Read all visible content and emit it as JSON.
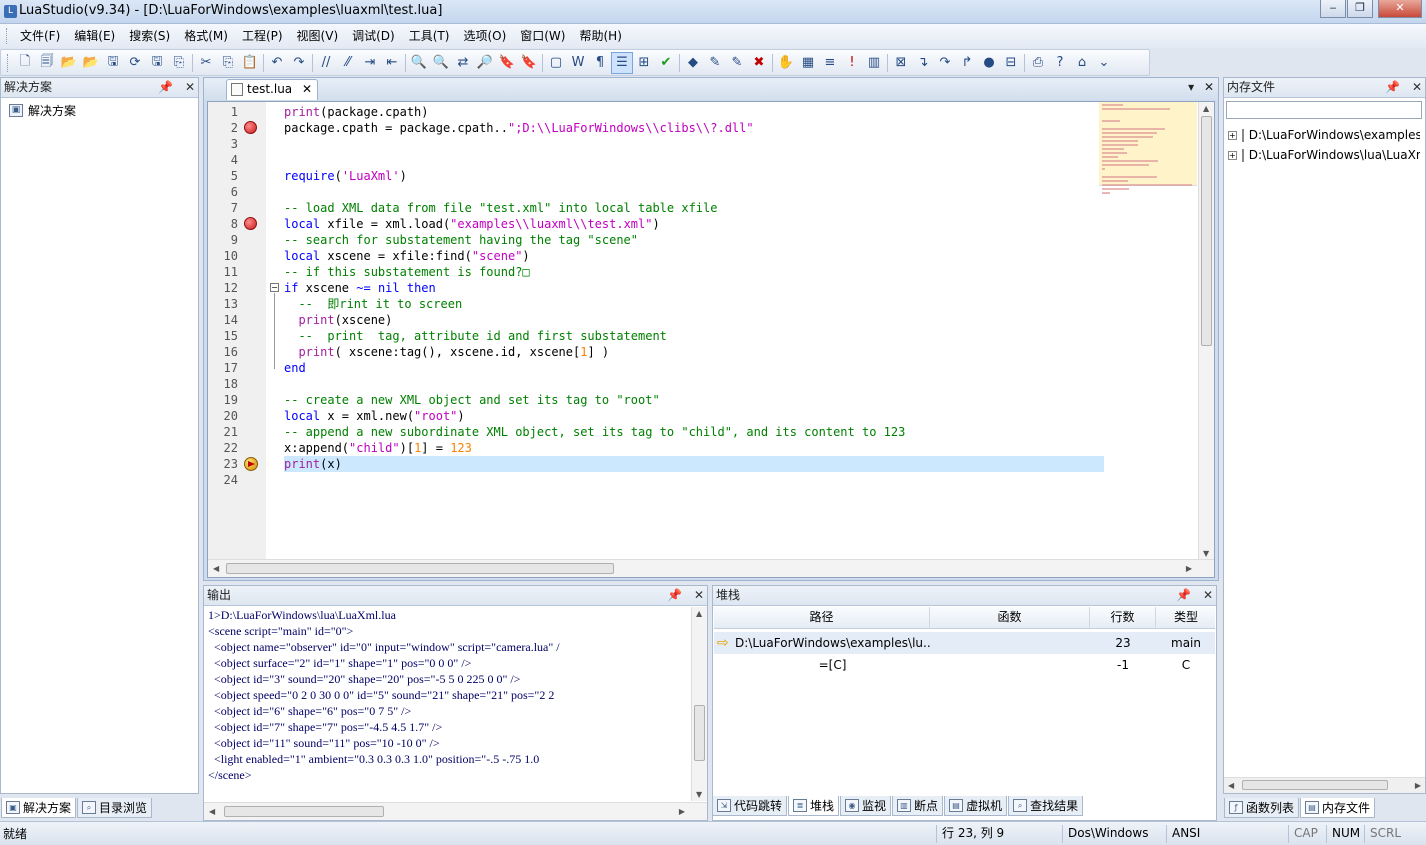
{
  "window": {
    "title": "LuaStudio(v9.34) - [D:\\LuaForWindows\\examples\\luaxml\\test.lua]",
    "buttons": {
      "minimize": "‒",
      "maximize": "❐",
      "close": "✕"
    }
  },
  "menu": [
    "文件(F)",
    "编辑(E)",
    "搜索(S)",
    "格式(M)",
    "工程(P)",
    "视图(V)",
    "调试(D)",
    "工具(T)",
    "选项(O)",
    "窗口(W)",
    "帮助(H)"
  ],
  "toolbar": {
    "icons": [
      "new-file-icon",
      "new-project-icon",
      "open-icon",
      "open-project-icon",
      "save-all-icon",
      "reload-icon",
      "save-icon",
      "save-copy-icon",
      "cut-icon",
      "copy-icon",
      "paste-icon",
      "undo-icon",
      "redo-icon",
      "comment-icon",
      "uncomment-icon",
      "indent-icon",
      "outdent-icon",
      "find-icon",
      "find-next-icon",
      "replace-icon",
      "find-in-files-icon",
      "bookmark-icon",
      "bookmark-next-icon",
      "frame-icon",
      "word-wrap-icon",
      "pilcrow-icon",
      "line-numbers-icon",
      "tree-icon",
      "check-icon",
      "compile-icon",
      "build-icon",
      "run-icon",
      "stop-icon",
      "hand-icon",
      "ruler-icon",
      "list-icon",
      "exclamation-icon",
      "columns-icon",
      "debug-icon",
      "step-into-icon",
      "step-over-icon",
      "step-out-icon",
      "breakpoint-icon",
      "watch-icon",
      "print-icon",
      "help-icon",
      "home-icon"
    ],
    "glyphs": [
      "🗋",
      "🗐",
      "📂",
      "📂",
      "🖫",
      "⟳",
      "🖫",
      "⎘",
      "✂",
      "⎘",
      "📋",
      "↶",
      "↷",
      "//",
      "⁄⁄",
      "⇥",
      "⇤",
      "🔍",
      "🔍",
      "⇄",
      "🔎",
      "🔖",
      "🔖",
      "▢",
      "W",
      "¶",
      "☰",
      "⊞",
      "✔",
      "◆",
      "✎",
      "✎",
      "✖",
      "✋",
      "▦",
      "≡",
      "!",
      "▥",
      "⊠",
      "↴",
      "↷",
      "↱",
      "●",
      "⊟",
      "⎙",
      "?",
      "⌂"
    ]
  },
  "left_panel": {
    "title": "解决方案",
    "pin": "📌",
    "close": "✕",
    "tree_item": "解决方案",
    "tabs": [
      "解决方案",
      "目录浏览"
    ]
  },
  "editor": {
    "tab_label": "test.lua",
    "tab_close": "✕",
    "tab_menu": "▾",
    "tab_close_all": "✕",
    "current_line": 23,
    "breakpoint_lines": [
      2,
      8
    ],
    "lines": [
      [
        {
          "t": "fn",
          "s": "print"
        },
        {
          "t": "",
          "s": "(package.cpath)"
        }
      ],
      [
        {
          "t": "",
          "s": "package.cpath = package.cpath.."
        },
        {
          "t": "str",
          "s": "\";D:\\\\LuaForWindows\\\\clibs\\\\?.dll\""
        }
      ],
      [],
      [],
      [
        {
          "t": "kw",
          "s": "require"
        },
        {
          "t": "",
          "s": "("
        },
        {
          "t": "str",
          "s": "'LuaXml'"
        },
        {
          "t": "",
          "s": ")"
        }
      ],
      [],
      [
        {
          "t": "cm",
          "s": "-- load XML data from file \"test.xml\" into local table xfile"
        }
      ],
      [
        {
          "t": "kw",
          "s": "local"
        },
        {
          "t": "",
          "s": " xfile = xml.load("
        },
        {
          "t": "str",
          "s": "\"examples\\\\luaxml\\\\test.xml\""
        },
        {
          "t": "",
          "s": ")"
        }
      ],
      [
        {
          "t": "cm",
          "s": "-- search for substatement having the tag \"scene\""
        }
      ],
      [
        {
          "t": "kw",
          "s": "local"
        },
        {
          "t": "",
          "s": " xscene = xfile:find("
        },
        {
          "t": "str",
          "s": "\"scene\""
        },
        {
          "t": "",
          "s": ")"
        }
      ],
      [
        {
          "t": "cm",
          "s": "-- if this substatement is found?□"
        }
      ],
      [
        {
          "t": "kw",
          "s": "if"
        },
        {
          "t": "",
          "s": " xscene "
        },
        {
          "t": "kw",
          "s": "~="
        },
        {
          "t": "",
          "s": " "
        },
        {
          "t": "kw",
          "s": "nil"
        },
        {
          "t": "",
          "s": " "
        },
        {
          "t": "kw",
          "s": "then"
        }
      ],
      [
        {
          "t": "cm",
          "s": "  --  即rint it to screen"
        }
      ],
      [
        {
          "t": "",
          "s": "  "
        },
        {
          "t": "fn",
          "s": "print"
        },
        {
          "t": "",
          "s": "(xscene)"
        }
      ],
      [
        {
          "t": "cm",
          "s": "  --  print  tag, attribute id and first substatement"
        }
      ],
      [
        {
          "t": "",
          "s": "  "
        },
        {
          "t": "fn",
          "s": "print"
        },
        {
          "t": "",
          "s": "( xscene:tag(), xscene.id, xscene["
        },
        {
          "t": "num",
          "s": "1"
        },
        {
          "t": "",
          "s": "] )"
        }
      ],
      [
        {
          "t": "kw",
          "s": "end"
        }
      ],
      [],
      [
        {
          "t": "cm",
          "s": "-- create a new XML object and set its tag to \"root\""
        }
      ],
      [
        {
          "t": "kw",
          "s": "local"
        },
        {
          "t": "",
          "s": " x = xml.new("
        },
        {
          "t": "str",
          "s": "\"root\""
        },
        {
          "t": "",
          "s": ")"
        }
      ],
      [
        {
          "t": "cm",
          "s": "-- append a new subordinate XML object, set its tag to \"child\", and its content to 123"
        }
      ],
      [
        {
          "t": "",
          "s": "x:append("
        },
        {
          "t": "str",
          "s": "\"child\""
        },
        {
          "t": "",
          "s": ")["
        },
        {
          "t": "num",
          "s": "1"
        },
        {
          "t": "",
          "s": "] = "
        },
        {
          "t": "num",
          "s": "123"
        }
      ],
      [
        {
          "t": "fn",
          "s": "print"
        },
        {
          "t": "",
          "s": "(x)"
        }
      ],
      []
    ]
  },
  "right_panel": {
    "title": "内存文件",
    "pin": "📌",
    "close": "✕",
    "items": [
      "D:\\LuaForWindows\\examples",
      "D:\\LuaForWindows\\lua\\LuaXml"
    ],
    "tabs": [
      "函数列表",
      "内存文件"
    ]
  },
  "output": {
    "title": "输出",
    "pin": "📌",
    "close": "✕",
    "lines": [
      "1>D:\\LuaForWindows\\lua\\LuaXml.lua",
      "<scene script=\"main\" id=\"0\">",
      "  <object name=\"observer\" id=\"0\" input=\"window\" script=\"camera.lua\" /",
      "  <object surface=\"2\" id=\"1\" shape=\"1\" pos=\"0 0 0\" />",
      "  <object id=\"3\" sound=\"20\" shape=\"20\" pos=\"-5 5 0 225 0 0\" />",
      "  <object speed=\"0 2 0 30 0 0\" id=\"5\" sound=\"21\" shape=\"21\" pos=\"2 2",
      "  <object id=\"6\" shape=\"6\" pos=\"0 7 5\" />",
      "  <object id=\"7\" shape=\"7\" pos=\"-4.5 4.5 1.7\" />",
      "  <object id=\"11\" sound=\"11\" pos=\"10 -10 0\" />",
      "  <light enabled=\"1\" ambient=\"0.3 0.3 0.3 1.0\" position=\"-.5 -.75 1.0",
      "</scene>"
    ]
  },
  "stack": {
    "title": "堆栈",
    "pin": "📌",
    "close": "✕",
    "columns": [
      "路径",
      "函数",
      "行数",
      "类型"
    ],
    "rows": [
      {
        "path": "D:\\LuaForWindows\\examples\\lu...",
        "func": "",
        "line": "23",
        "type": "main"
      },
      {
        "path": "=[C]",
        "func": "",
        "line": "-1",
        "type": "C"
      }
    ],
    "tabs": [
      "代码跳转",
      "堆栈",
      "监视",
      "断点",
      "虚拟机",
      "查找结果"
    ]
  },
  "status": {
    "ready": "就绪",
    "position": "行 23, 列 9",
    "line_ending": "Dos\\Windows",
    "encoding": "ANSI",
    "cap": "CAP",
    "num": "NUM",
    "scrl": "SCRL"
  }
}
